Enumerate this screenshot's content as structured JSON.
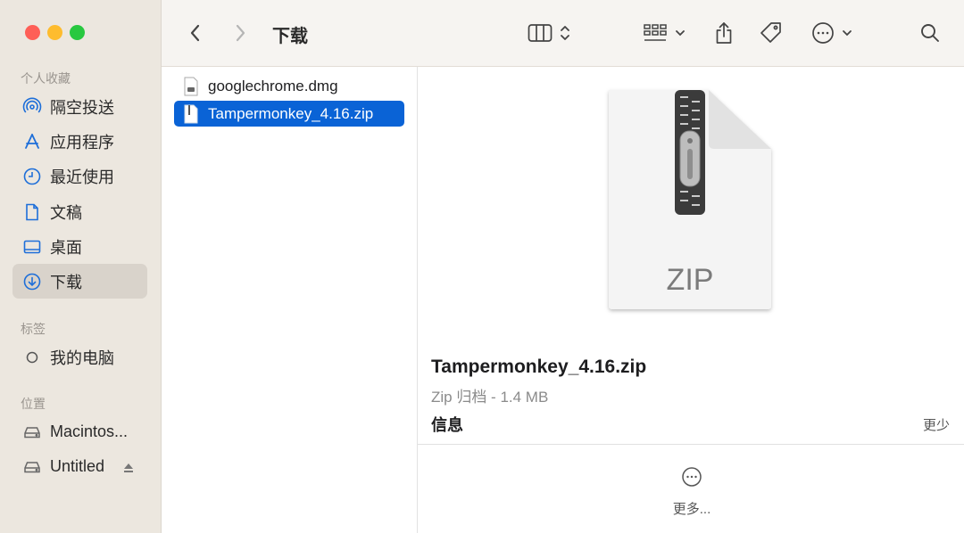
{
  "sidebar": {
    "favorites_label": "个人收藏",
    "favorites": [
      {
        "label": "隔空投送",
        "icon": "airdrop-icon"
      },
      {
        "label": "应用程序",
        "icon": "applications-icon"
      },
      {
        "label": "最近使用",
        "icon": "clock-icon"
      },
      {
        "label": "文稿",
        "icon": "document-icon"
      },
      {
        "label": "桌面",
        "icon": "desktop-icon"
      },
      {
        "label": "下载",
        "icon": "download-icon",
        "active": true
      }
    ],
    "tags_label": "标签",
    "tags": [
      {
        "label": "我的电脑",
        "icon": "tag-circle-icon"
      }
    ],
    "locations_label": "位置",
    "locations": [
      {
        "label": "Macintos...",
        "icon": "disk-icon"
      },
      {
        "label": "Untitled",
        "icon": "disk-icon",
        "ejectable": true
      }
    ]
  },
  "toolbar": {
    "title": "下载",
    "icons": [
      "back-icon",
      "forward-icon",
      "column-view-icon",
      "sort-stepper-icon",
      "group-grid-icon",
      "chevron-down-icon",
      "share-icon",
      "tag-icon",
      "more-icon",
      "chevron-down-icon",
      "search-icon"
    ]
  },
  "files": [
    {
      "name": "googlechrome.dmg",
      "selected": false
    },
    {
      "name": "Tampermonkey_4.16.zip",
      "selected": true
    }
  ],
  "preview": {
    "icon_label": "ZIP",
    "name": "Tampermonkey_4.16.zip",
    "kind": "Zip 归档 - 1.4 MB",
    "info_label": "信息",
    "less_label": "更少",
    "more_label": "更多..."
  },
  "colors": {
    "selection": "#0a63d6",
    "sidebar_bg": "#ece7df",
    "accent_icon": "#1e6fd9"
  }
}
